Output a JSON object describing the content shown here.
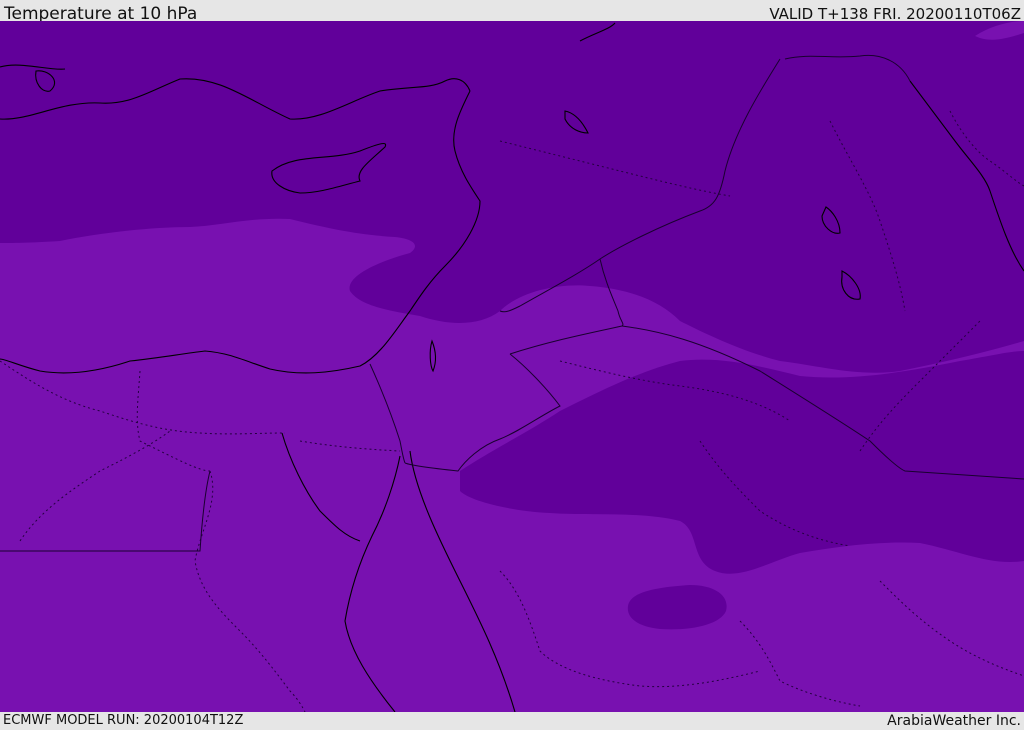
{
  "header": {
    "title": "Temperature at 10 hPa",
    "valid": "VALID T+138 FRI. 20200110T06Z"
  },
  "footer": {
    "model_run": "ECMWF MODEL RUN: 20200104T12Z",
    "credit": "ArabiaWeather Inc."
  },
  "map": {
    "colors": {
      "cold_band": "#61009a",
      "warm_band": "#7811b0",
      "coastline": "#000000",
      "border": "#2a0044"
    }
  }
}
